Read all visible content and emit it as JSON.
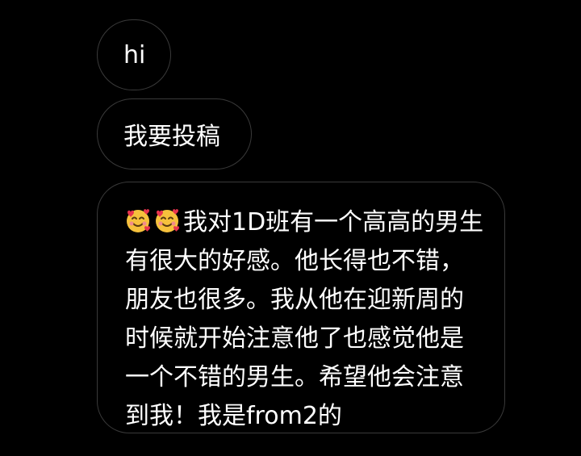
{
  "messages": [
    {
      "text": "hi"
    },
    {
      "text": "我要投稿"
    },
    {
      "emojis": [
        "smiling-face-with-hearts-icon",
        "smiling-face-with-hearts-icon"
      ],
      "text": "我对1D班有一个高高的男生有很大的好感。他长得也不错，朋友也很多。我从他在迎新周的时候就开始注意他了也感觉他是一个不错的男生。希望他会注意到我！我是from2的"
    }
  ],
  "colors": {
    "background": "#000000",
    "bubble_border": "#3a3a3a",
    "text": "#ffffff",
    "emoji_face": "#f6c13c",
    "emoji_heart": "#e8344e"
  }
}
